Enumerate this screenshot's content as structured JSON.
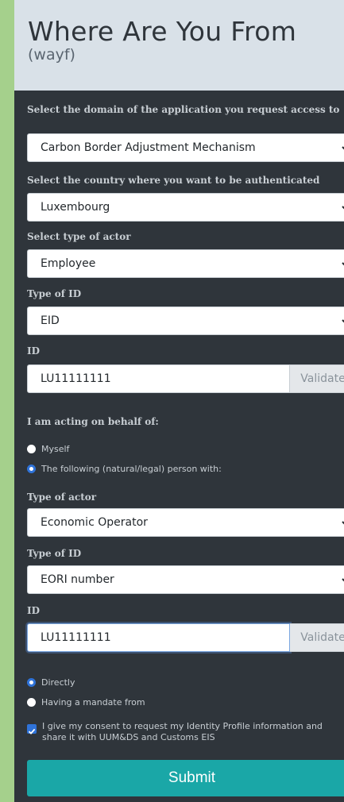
{
  "header": {
    "title": "Where Are You From",
    "subtitle": "(wayf)"
  },
  "domain": {
    "label": "Select the domain of the application you request access to",
    "value": "Carbon Border Adjustment Mechanism"
  },
  "country": {
    "label": "Select the country where you want to be authenticated",
    "value": "Luxembourg"
  },
  "actor_type": {
    "label": "Select type of actor",
    "value": "Employee"
  },
  "id_type": {
    "label": "Type of ID",
    "value": "EID"
  },
  "id": {
    "label": "ID",
    "value": "LU11111111",
    "validate_label": "Validate"
  },
  "behalf": {
    "label": "I am acting on behalf of:",
    "options": [
      "Myself",
      "The following (natural/legal) person with:"
    ],
    "selected": 1
  },
  "person": {
    "actor_type": {
      "label": "Type of actor",
      "value": "Economic Operator"
    },
    "id_type": {
      "label": "Type of ID",
      "value": "EORI number"
    },
    "id": {
      "label": "ID",
      "value": "LU11111111",
      "validate_label": "Validate"
    }
  },
  "relation": {
    "options": [
      "Directly",
      "Having a mandate from"
    ],
    "selected": 0
  },
  "consent": {
    "checked": true,
    "text": "I give my consent to request my Identity Profile information and share it with UUM&DS and Customs EIS"
  },
  "submit_label": "Submit",
  "colors": {
    "background": "#a5d08c",
    "panel": "#2f353b",
    "header": "#d9e1e8",
    "accent": "#2f73d9",
    "submit": "#1aa7a7"
  }
}
